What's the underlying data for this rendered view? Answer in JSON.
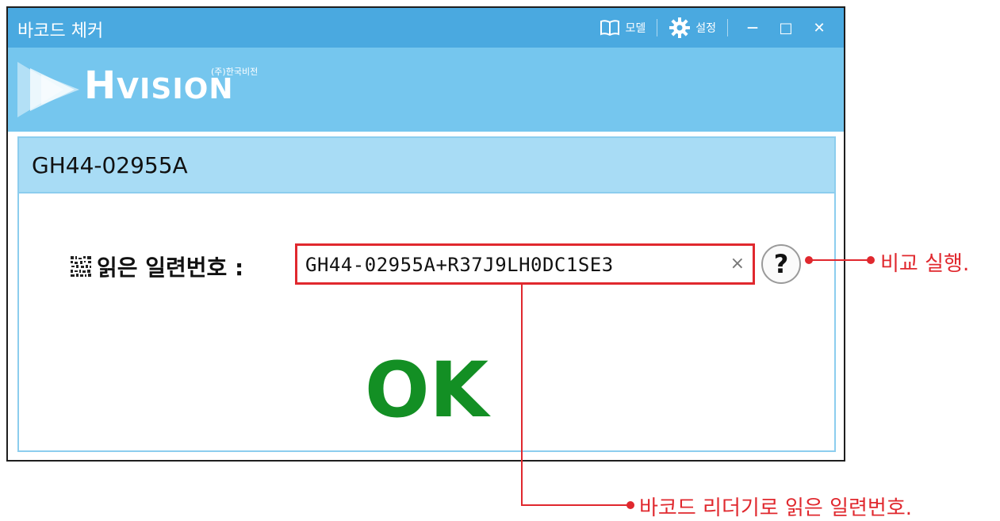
{
  "window": {
    "title": "바코드 체커",
    "toolbar": {
      "model_label": "모델",
      "settings_label": "설정",
      "minimize_glyph": "—",
      "maximize_glyph": "□",
      "close_glyph": "✕"
    }
  },
  "logo": {
    "brand_h": "H",
    "brand_rest": "VISION",
    "company": "(주)한국비전"
  },
  "panel": {
    "model_code": "GH44-02955A",
    "serial_label": "읽은 일련번호 :",
    "serial_value": "GH44-02955A+R37J9LH0DC1SE3",
    "clear_glyph": "×",
    "help_glyph": "?",
    "result": "OK"
  },
  "annotations": {
    "help_callout": "비교 실행.",
    "serial_callout": "바코드 리더기로 읽은 일련번호."
  },
  "colors": {
    "titlebar": "#4aa9e0",
    "logo_band": "#75c6ee",
    "panel_header": "#a8dcf5",
    "ok_green": "#138f24",
    "callout_red": "#e0282e"
  }
}
